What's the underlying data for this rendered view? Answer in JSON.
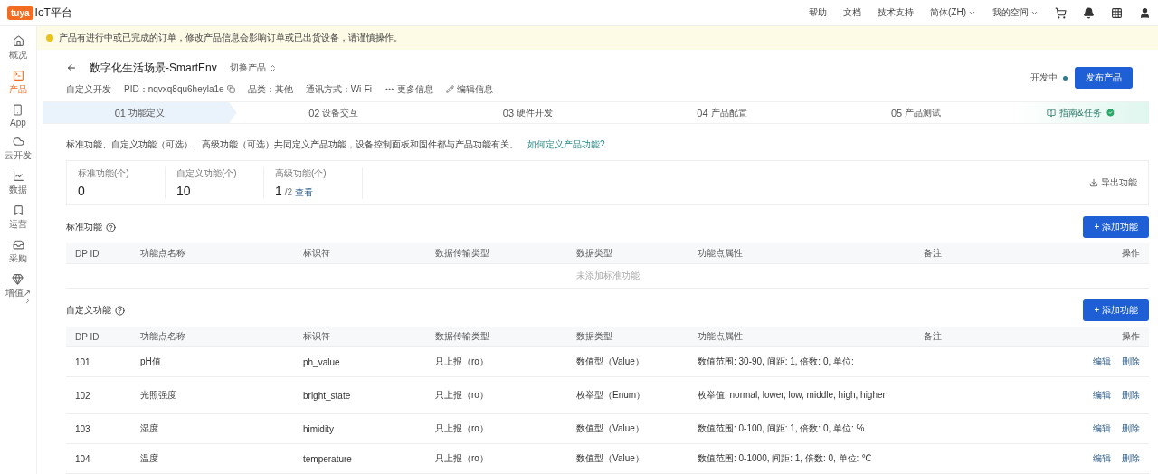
{
  "topbar": {
    "brand": "tuya",
    "title": "IoT平台",
    "links": [
      {
        "label": "帮助",
        "dropdown": false
      },
      {
        "label": "文档",
        "dropdown": false
      },
      {
        "label": "技术支持",
        "dropdown": false
      },
      {
        "label": "简体(ZH)",
        "dropdown": true
      },
      {
        "label": "我的空间",
        "dropdown": true
      }
    ]
  },
  "sidebar": {
    "items": [
      {
        "label": "概况",
        "selected": false
      },
      {
        "label": "产品",
        "selected": true
      },
      {
        "label": "App",
        "selected": false
      },
      {
        "label": "云开发",
        "selected": false
      },
      {
        "label": "数据",
        "selected": false
      },
      {
        "label": "运营",
        "selected": false
      },
      {
        "label": "采购",
        "selected": false
      },
      {
        "label": "增值↗",
        "selected": false
      }
    ]
  },
  "notice": "产品有进行中或已完成的订单，修改产品信息会影响订单或已出货设备，请谨慎操作。",
  "product": {
    "name": "数字化生活场景-SmartEnv",
    "switch": "切换产品",
    "meta": [
      "自定义开发",
      "PID：nqvxq8qu6heyla1e",
      "品类：其他",
      "通讯方式：Wi-Fi"
    ],
    "more": "更多信息",
    "edit": "编辑信息",
    "status": "开发中",
    "publish": "发布产品"
  },
  "steps": [
    {
      "num": "01",
      "label": "功能定义",
      "selected": true
    },
    {
      "num": "02",
      "label": "设备交互",
      "selected": false
    },
    {
      "num": "03",
      "label": "硬件开发",
      "selected": false
    },
    {
      "num": "04",
      "label": "产品配置",
      "selected": false
    },
    {
      "num": "05",
      "label": "产品测试",
      "selected": false
    }
  ],
  "guide": {
    "label": "指南&任务",
    "done": true
  },
  "description": "标准功能、自定义功能（可选）、高级功能（可选）共同定义产品功能，设备控制面板和固件都与产品功能有关。",
  "help_link": "如何定义产品功能?",
  "stats": [
    {
      "label": "标准功能(个)",
      "value": "0"
    },
    {
      "label": "自定义功能(个)",
      "value": "10"
    },
    {
      "label": "高级功能(个)",
      "value": "1",
      "total": "/2",
      "link": "查看"
    }
  ],
  "export": "导出功能",
  "standard": {
    "title": "标准功能",
    "add": "+ 添加功能",
    "columns": [
      "DP ID",
      "功能点名称",
      "标识符",
      "数据传输类型",
      "数据类型",
      "功能点属性",
      "备注",
      "操作"
    ],
    "empty": "未添加标准功能"
  },
  "custom": {
    "title": "自定义功能",
    "add": "+ 添加功能",
    "columns": [
      "DP ID",
      "功能点名称",
      "标识符",
      "数据传输类型",
      "数据类型",
      "功能点属性",
      "备注",
      "操作"
    ],
    "rows": [
      {
        "id": "101",
        "name": "pH值",
        "code": "ph_value",
        "transfer": "只上报（ro）",
        "type": "数值型（Value）",
        "props": "数值范围: 30-90, 间距: 1, 倍数: 0, 单位:",
        "actions": [
          "编辑",
          "删除"
        ]
      },
      {
        "id": "102",
        "name": "光照强度",
        "code": "bright_state",
        "transfer": "只上报（ro）",
        "type": "枚举型（Enum）",
        "props": "枚举值: normal, lower, low, middle, high, higher",
        "actions": [
          "编辑",
          "删除"
        ]
      },
      {
        "id": "103",
        "name": "湿度",
        "code": "himidity",
        "transfer": "只上报（ro）",
        "type": "数值型（Value）",
        "props": "数值范围: 0-100, 间距: 1, 倍数: 0, 单位: %",
        "actions": [
          "编辑",
          "删除"
        ]
      },
      {
        "id": "104",
        "name": "温度",
        "code": "temperature",
        "transfer": "只上报（ro）",
        "type": "数值型（Value）",
        "props": "数值范围: 0-1000, 间距: 1, 倍数: 0, 单位: ℃",
        "actions": [
          "编辑",
          "删除"
        ]
      }
    ]
  }
}
